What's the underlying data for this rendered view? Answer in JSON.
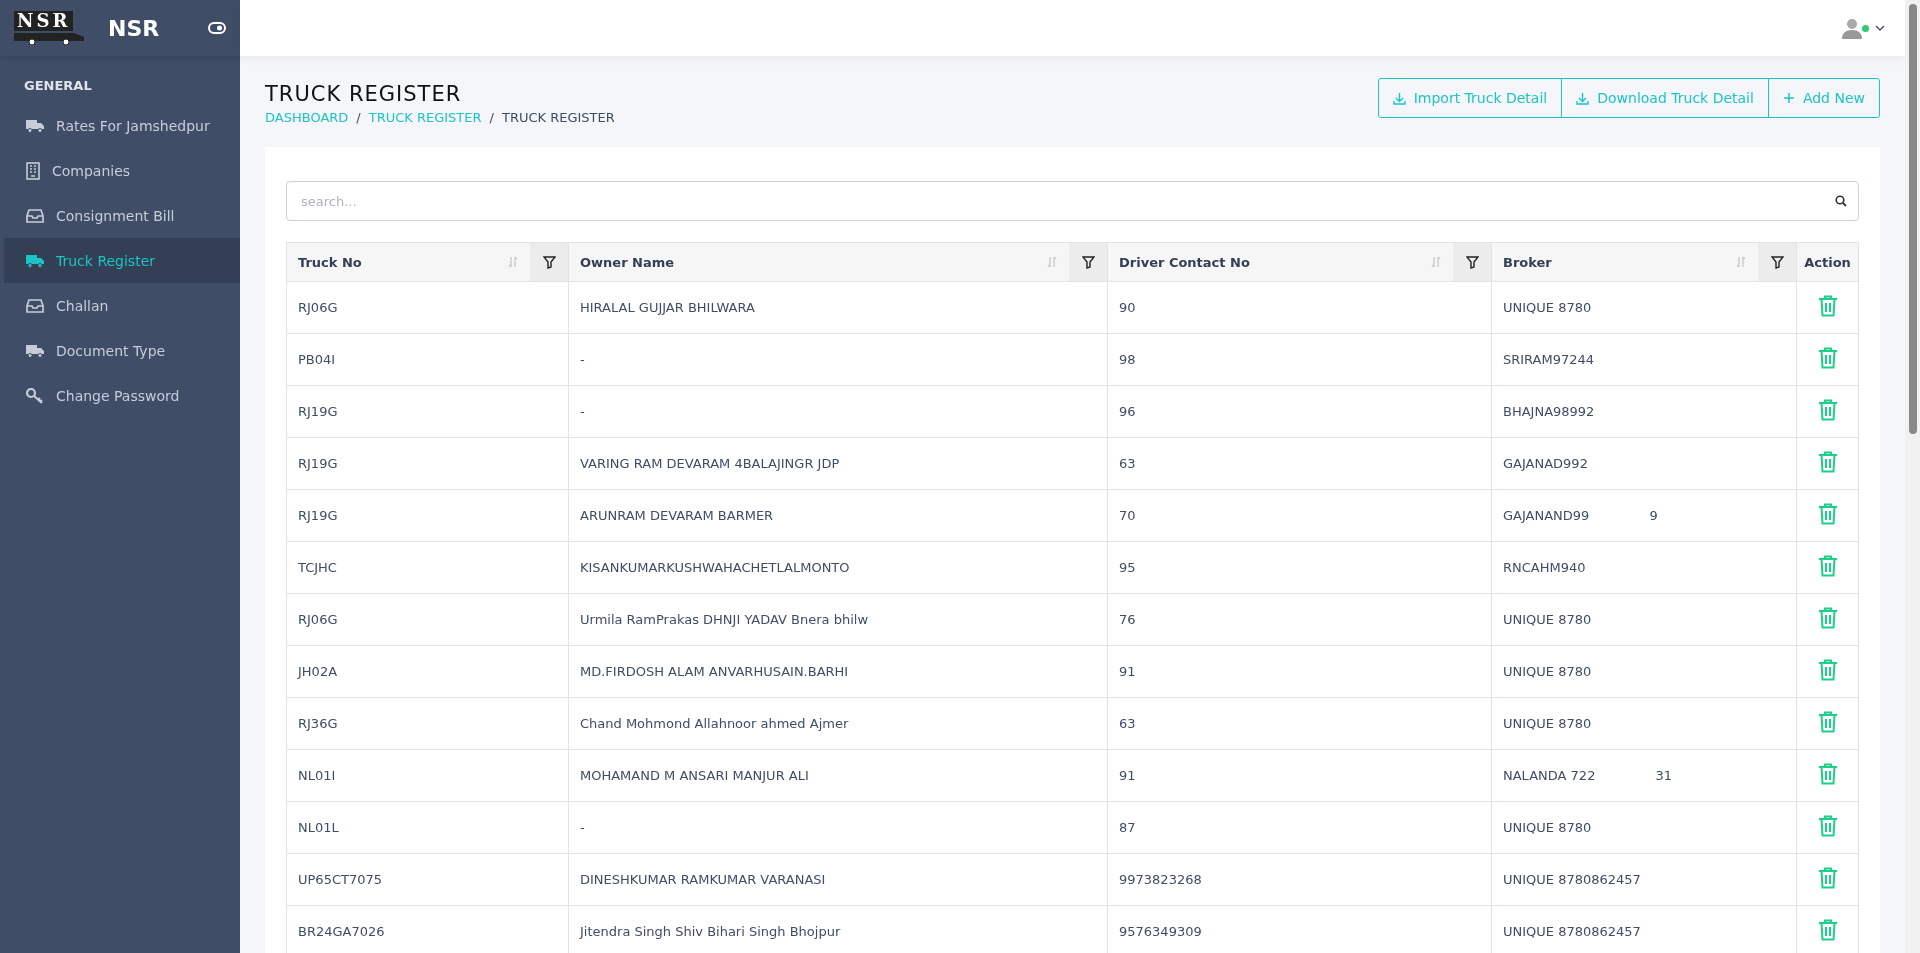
{
  "sidebar": {
    "brand": {
      "logo_text": "NSR",
      "name": "NSR"
    },
    "section": "GENERAL",
    "items": [
      {
        "label": "Rates For Jamshedpur",
        "selected": false
      },
      {
        "label": "Companies",
        "selected": false
      },
      {
        "label": "Consignment Bill",
        "selected": false
      },
      {
        "label": "Truck Register",
        "selected": true
      },
      {
        "label": "Challan",
        "selected": false
      },
      {
        "label": "Document Type",
        "selected": false
      },
      {
        "label": "Change Password",
        "selected": false
      }
    ]
  },
  "topbar": {
    "user": {
      "online": true
    }
  },
  "page": {
    "title": "TRUCK REGISTER",
    "breadcrumb": [
      {
        "kind": "link",
        "label": "DASHBOARD"
      },
      {
        "kind": "separator",
        "label": "/"
      },
      {
        "kind": "link",
        "label": "TRUCK REGISTER"
      },
      {
        "kind": "separator",
        "label": "/"
      },
      {
        "kind": "current",
        "label": "TRUCK REGISTER"
      }
    ],
    "actions": [
      {
        "label": "Import Truck Detail"
      },
      {
        "label": "Download Truck Detail"
      },
      {
        "label": "Add New"
      }
    ]
  },
  "search": {
    "placeholder": "search..."
  },
  "table": {
    "columns": [
      {
        "label": "Truck No",
        "filter": true
      },
      {
        "label": "Owner Name",
        "filter": true
      },
      {
        "label": "Driver Contact No",
        "filter": true
      },
      {
        "label": "Broker",
        "filter": true
      },
      {
        "label": "Action",
        "filter": false
      }
    ],
    "rows": [
      {
        "truck_no": "RJ06G",
        "owner": "HIRALAL GUJJAR BHILWARA",
        "contact": "90",
        "broker": "UNIQUE 8780"
      },
      {
        "truck_no": "PB04I",
        "owner": "-",
        "contact": "98",
        "broker": "SRIRAM97244"
      },
      {
        "truck_no": "RJ19G",
        "owner": "-",
        "contact": "96",
        "broker": "BHAJNA98992"
      },
      {
        "truck_no": "RJ19G",
        "owner": "VARING RAM DEVARAM 4BALAJINGR JDP",
        "contact": "63",
        "broker": "GAJANAD992"
      },
      {
        "truck_no": "RJ19G",
        "owner": "ARUNRAM DEVARAM BARMER",
        "contact": "70",
        "broker": "GAJANAND99",
        "broker_tail": "9"
      },
      {
        "truck_no": "TCJHC",
        "owner": "KISANKUMARKUSHWAHACHETLALMONTO",
        "contact": "95",
        "broker": "RNCAHM940"
      },
      {
        "truck_no": "RJ06G",
        "owner": "Urmila RamPrakas DHNJI YADAV Bnera bhilw",
        "contact": "76",
        "broker": "UNIQUE 8780"
      },
      {
        "truck_no": "JH02A",
        "owner": "MD.FIRDOSH ALAM ANVARHUSAIN.BARHI",
        "contact": "91",
        "broker": "UNIQUE 8780"
      },
      {
        "truck_no": "RJ36G",
        "owner": "Chand Mohmond Allahnoor ahmed Ajmer",
        "contact": "63",
        "broker": "UNIQUE 8780"
      },
      {
        "truck_no": "NL01I",
        "owner": "MOHAMAND M ANSARI MANJUR ALI",
        "contact": "91",
        "broker": "NALANDA 722",
        "broker_tail": "31"
      },
      {
        "truck_no": "NL01L",
        "owner": "-",
        "contact": "87",
        "broker": "UNIQUE 8780"
      },
      {
        "truck_no": "UP65CT7075",
        "owner": "DINESHKUMAR RAMKUMAR VARANASI",
        "contact": "9973823268",
        "broker": "UNIQUE 8780862457"
      },
      {
        "truck_no": "BR24GA7026",
        "owner": "Jitendra Singh Shiv Bihari Singh Bhojpur",
        "contact": "9576349309",
        "broker": "UNIQUE 8780862457"
      }
    ]
  }
}
